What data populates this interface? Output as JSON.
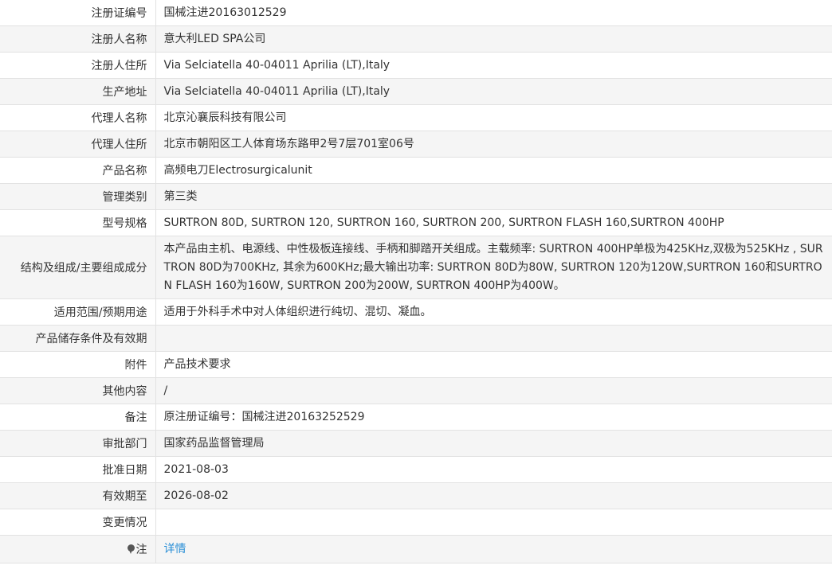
{
  "rows": [
    {
      "label": "注册证编号",
      "value": "国械注进20163012529"
    },
    {
      "label": "注册人名称",
      "value": "意大利LED SPA公司"
    },
    {
      "label": "注册人住所",
      "value": "Via Selciatella 40-04011 Aprilia (LT),Italy"
    },
    {
      "label": "生产地址",
      "value": "Via Selciatella 40-04011 Aprilia (LT),Italy"
    },
    {
      "label": "代理人名称",
      "value": "北京沁襄辰科技有限公司"
    },
    {
      "label": "代理人住所",
      "value": "北京市朝阳区工人体育场东路甲2号7层701室06号"
    },
    {
      "label": "产品名称",
      "value": "高频电刀Electrosurgicalunit"
    },
    {
      "label": "管理类别",
      "value": "第三类"
    },
    {
      "label": "型号规格",
      "value": "SURTRON 80D, SURTRON 120, SURTRON 160, SURTRON 200, SURTRON FLASH 160,SURTRON 400HP"
    },
    {
      "label": "结构及组成/主要组成成分",
      "value": "本产品由主机、电源线、中性极板连接线、手柄和脚踏开关组成。主载频率: SURTRON 400HP单极为425KHz,双极为525KHz , SURTRON 80D为700KHz, 其余为600KHz;最大输出功率: SURTRON 80D为80W, SURTRON 120为120W,SURTRON 160和SURTRON FLASH 160为160W, SURTRON 200为200W, SURTRON 400HP为400W。"
    },
    {
      "label": "适用范围/预期用途",
      "value": "适用于外科手术中对人体组织进行纯切、混切、凝血。"
    },
    {
      "label": "产品储存条件及有效期",
      "value": ""
    },
    {
      "label": "附件",
      "value": "产品技术要求"
    },
    {
      "label": "其他内容",
      "value": "/"
    },
    {
      "label": "备注",
      "value": "原注册证编号：国械注进20163252529"
    },
    {
      "label": "审批部门",
      "value": "国家药品监督管理局"
    },
    {
      "label": "批准日期",
      "value": "2021-08-03"
    },
    {
      "label": "有效期至",
      "value": "2026-08-02"
    },
    {
      "label": "变更情况",
      "value": ""
    }
  ],
  "note": {
    "icon": "pin-icon",
    "label": "注",
    "link_text": "详情",
    "link_color": "#2a8fd6"
  }
}
